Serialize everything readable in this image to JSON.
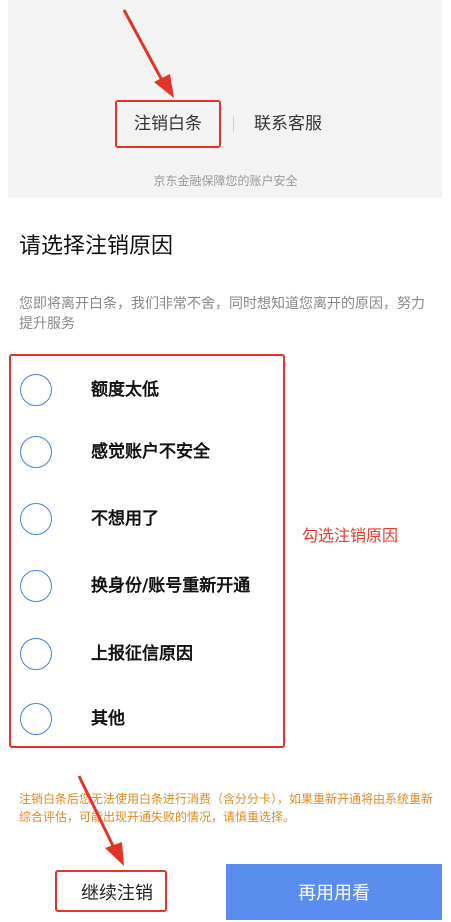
{
  "top": {
    "cancel_link": "注销白条",
    "service_link": "联系客服",
    "safety_note": "京东金融保障您的账户安全"
  },
  "main": {
    "title": "请选择注销原因",
    "intro": "您即将离开白条，我们非常不舍，同时想知道您离开的原因，努力提升服务",
    "reasons": [
      {
        "label": "额度太低"
      },
      {
        "label": "感觉账户不安全"
      },
      {
        "label": "不想用了"
      },
      {
        "label": "换身份/账号重新开通"
      },
      {
        "label": "上报征信原因"
      },
      {
        "label": "其他"
      }
    ],
    "warning": "注销白条后您无法使用白条进行消费（含分分卡），如果重新开通将由系统重新综合评估，可能出现开通失败的情况，请慎重选择。"
  },
  "annotation": {
    "text": "勾选注销原因",
    "color": "#e63b2e"
  },
  "bottom": {
    "continue_label": "继续注销",
    "try_label": "再用用看"
  },
  "colors": {
    "primary_blue": "#5b8def",
    "radio_border": "#4a7fe0",
    "warning_orange": "#e38a1e",
    "highlight_red": "#e3342a"
  }
}
